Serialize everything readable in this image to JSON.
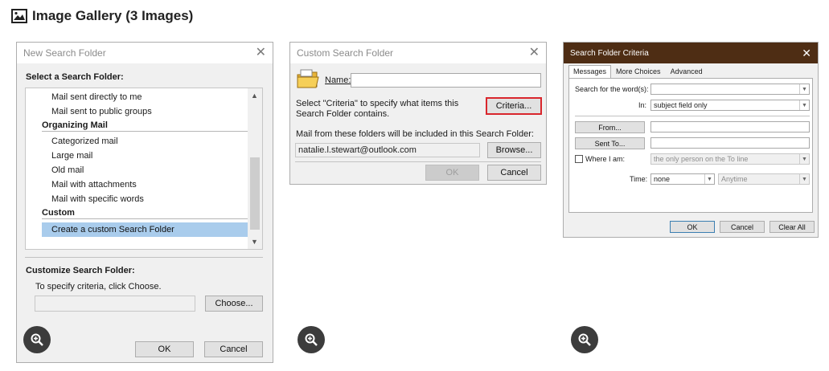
{
  "gallery": {
    "title": "Image Gallery (3 Images)"
  },
  "dialog1": {
    "title": "New Search Folder",
    "select_label": "Select a Search Folder:",
    "list": {
      "items": [
        {
          "text": "Mail sent directly to me",
          "type": "item"
        },
        {
          "text": "Mail sent to public groups",
          "type": "item"
        },
        {
          "text": "Organizing Mail",
          "type": "group"
        },
        {
          "text": "Categorized mail",
          "type": "item"
        },
        {
          "text": "Large mail",
          "type": "item"
        },
        {
          "text": "Old mail",
          "type": "item"
        },
        {
          "text": "Mail with attachments",
          "type": "item"
        },
        {
          "text": "Mail with specific words",
          "type": "item"
        },
        {
          "text": "Custom",
          "type": "group"
        },
        {
          "text": "Create a custom Search Folder",
          "type": "selected"
        }
      ]
    },
    "customize_label": "Customize Search Folder:",
    "criteria_hint": "To specify criteria, click Choose.",
    "criteria_value": "",
    "choose_button": "Choose...",
    "ok_button": "OK",
    "cancel_button": "Cancel"
  },
  "dialog2": {
    "title": "Custom Search Folder",
    "name_label": "Name:",
    "name_value": "",
    "criteria_text": "Select \"Criteria\" to specify what items this Search Folder contains.",
    "criteria_button": "Criteria...",
    "folders_label": "Mail from these folders will be included in this Search Folder:",
    "folder_value": "natalie.l.stewart@outlook.com",
    "browse_button": "Browse...",
    "ok_button": "OK",
    "cancel_button": "Cancel",
    "highlight_color": "#d9262c"
  },
  "dialog3": {
    "title": "Search Folder Criteria",
    "tabs": [
      "Messages",
      "More Choices",
      "Advanced"
    ],
    "search_words_label": "Search for the word(s):",
    "search_words_value": "",
    "in_label": "In:",
    "in_value": "subject field only",
    "from_button": "From...",
    "from_value": "",
    "sent_to_button": "Sent To...",
    "sent_to_value": "",
    "where_label": "Where I am:",
    "where_checked": false,
    "where_value": "the only person on the To line",
    "time_label": "Time:",
    "time_value": "none",
    "time_range_value": "Anytime",
    "ok_button": "OK",
    "cancel_button": "Cancel",
    "clear_all_button": "Clear All",
    "titlebar_color": "#4e2d14"
  }
}
